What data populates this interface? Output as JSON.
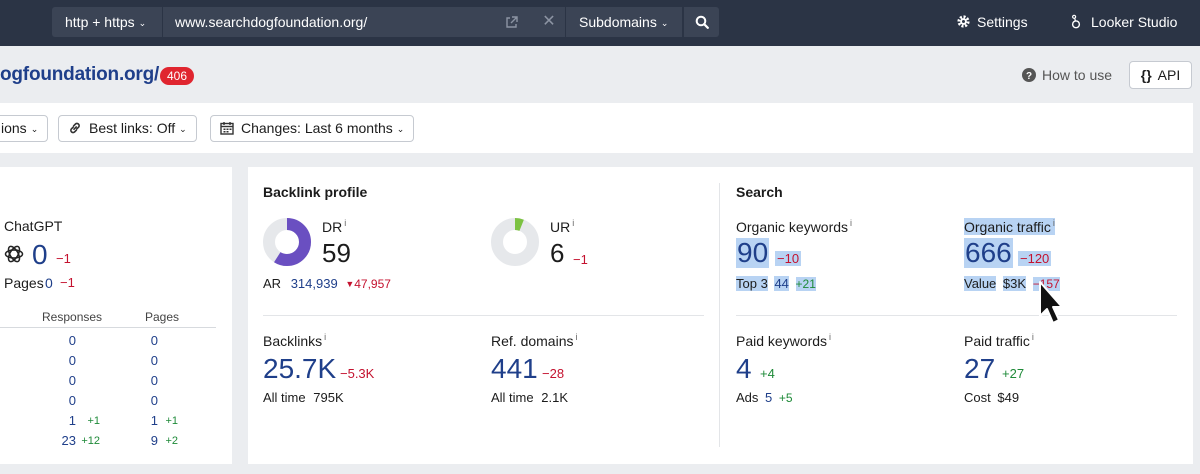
{
  "topbar": {
    "protocol": "http + https",
    "url": "www.searchdogfoundation.org/",
    "mode": "Subdomains",
    "settings": "Settings",
    "looker": "Looker Studio"
  },
  "title": {
    "domain": "ogfoundation.org/",
    "badge": "406",
    "how_to_use": "How to use",
    "api": "API"
  },
  "filters": {
    "versions": "ions",
    "best_links": "Best links: Off",
    "changes": "Changes: Last 6 months"
  },
  "ai": {
    "label": "ChatGPT",
    "value": "0",
    "delta": "−1",
    "pages_label": "Pages",
    "pages_value": "0",
    "pages_delta": "−1",
    "col_responses": "Responses",
    "col_pages": "Pages",
    "rows": [
      {
        "responses": "0",
        "responses_delta": "",
        "pages": "0",
        "pages_delta": ""
      },
      {
        "responses": "0",
        "responses_delta": "",
        "pages": "0",
        "pages_delta": ""
      },
      {
        "responses": "0",
        "responses_delta": "",
        "pages": "0",
        "pages_delta": ""
      },
      {
        "responses": "0",
        "responses_delta": "",
        "pages": "0",
        "pages_delta": ""
      },
      {
        "responses": "1",
        "responses_delta": "+1",
        "pages": "1",
        "pages_delta": "+1"
      },
      {
        "responses": "23",
        "responses_delta": "+12",
        "pages": "9",
        "pages_delta": "+2"
      }
    ]
  },
  "backlink_profile": {
    "heading": "Backlink profile",
    "dr_label": "DR",
    "dr_value": "59",
    "dr_fill": 0.59,
    "ar_label": "AR",
    "ar_value": "314,939",
    "ar_delta": "47,957",
    "ur_label": "UR",
    "ur_value": "6",
    "ur_delta": "−1",
    "ur_fill": 0.06,
    "backlinks_label": "Backlinks",
    "backlinks_value": "25.7K",
    "backlinks_delta": "−5.3K",
    "backlinks_alltime_label": "All time",
    "backlinks_alltime": "795K",
    "refdomains_label": "Ref. domains",
    "refdomains_value": "441",
    "refdomains_delta": "−28",
    "refdomains_alltime_label": "All time",
    "refdomains_alltime": "2.1K"
  },
  "search": {
    "heading": "Search",
    "org_kw_label": "Organic keywords",
    "org_kw_value": "90",
    "org_kw_delta": "−10",
    "top3_label": "Top 3",
    "top3_value": "44",
    "top3_delta": "+21",
    "org_traffic_label": "Organic traffic",
    "org_traffic_value": "666",
    "org_traffic_delta": "−120",
    "value_label": "Value",
    "value_value": "$3K",
    "value_delta": "−157",
    "paid_kw_label": "Paid keywords",
    "paid_kw_value": "4",
    "paid_kw_delta": "+4",
    "ads_label": "Ads",
    "ads_value": "5",
    "ads_delta": "+5",
    "paid_traffic_label": "Paid traffic",
    "paid_traffic_value": "27",
    "paid_traffic_delta": "+27",
    "cost_label": "Cost",
    "cost_value": "$49"
  },
  "colors": {
    "topbar": "#2b3445",
    "dr_ring": "#6a4fc1",
    "ur_ring": "#7cc242",
    "ring_track": "#e6e8eb",
    "badge": "#e0252f",
    "link": "#1f3f8a",
    "negative": "#c4122f",
    "positive": "#1e8a38"
  }
}
